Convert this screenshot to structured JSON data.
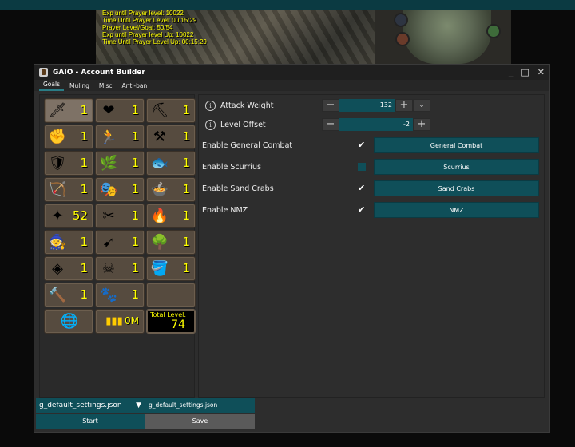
{
  "overlay": {
    "lines": [
      "Exp until Prayer level: 10022",
      "Time Until Prayer Level: 00:15:29",
      "Prayer Level/Goal: 50/54",
      "Exp until Prayer level Up: 10022",
      "Time Until Prayer Level Up: 00:15:29"
    ],
    "text_color": "#ffff00"
  },
  "window": {
    "title": "GAIO - Account Builder",
    "controls": [
      "_",
      "□",
      "✕"
    ]
  },
  "tabs": [
    "Goals",
    "Muling",
    "Misc",
    "Anti-ban"
  ],
  "skills": [
    {
      "icon": "attack",
      "glyph": "🗡",
      "level": "1",
      "selected": true
    },
    {
      "icon": "hitpoints",
      "glyph": "❤",
      "level": "1"
    },
    {
      "icon": "mining",
      "glyph": "⛏",
      "level": "1"
    },
    {
      "icon": "strength",
      "glyph": "✊",
      "level": "1"
    },
    {
      "icon": "agility",
      "glyph": "🏃",
      "level": "1"
    },
    {
      "icon": "smithing",
      "glyph": "⚒",
      "level": "1"
    },
    {
      "icon": "defence",
      "glyph": "🛡",
      "level": "1"
    },
    {
      "icon": "herblore",
      "glyph": "🌿",
      "level": "1"
    },
    {
      "icon": "fishing",
      "glyph": "🐟",
      "level": "1"
    },
    {
      "icon": "ranged",
      "glyph": "🏹",
      "level": "1"
    },
    {
      "icon": "thieving",
      "glyph": "🎭",
      "level": "1"
    },
    {
      "icon": "cooking",
      "glyph": "🍲",
      "level": "1"
    },
    {
      "icon": "prayer",
      "glyph": "✦",
      "level": "52"
    },
    {
      "icon": "crafting",
      "glyph": "✂",
      "level": "1"
    },
    {
      "icon": "firemaking",
      "glyph": "🔥",
      "level": "1"
    },
    {
      "icon": "magic",
      "glyph": "🧙",
      "level": "1"
    },
    {
      "icon": "fletching",
      "glyph": "➹",
      "level": "1"
    },
    {
      "icon": "woodcutting",
      "glyph": "🌳",
      "level": "1"
    },
    {
      "icon": "runecraft",
      "glyph": "◈",
      "level": "1"
    },
    {
      "icon": "slayer",
      "glyph": "☠",
      "level": "1"
    },
    {
      "icon": "farming",
      "glyph": "🪣",
      "level": "1"
    },
    {
      "icon": "construction",
      "glyph": "🔨",
      "level": "1"
    },
    {
      "icon": "hunter",
      "glyph": "🐾",
      "level": "1"
    }
  ],
  "bottom": {
    "money_value": "0M",
    "total_label": "Total Level:",
    "total_value": "74"
  },
  "settings": {
    "attack_weight": {
      "label": "Attack Weight",
      "value": "132"
    },
    "level_offset": {
      "label": "Level Offset",
      "value": "-2"
    },
    "toggles": [
      {
        "label": "Enable General Combat",
        "checked": true,
        "button": "General Combat"
      },
      {
        "label": "Enable Scurrius",
        "checked": false,
        "button": "Scurrius"
      },
      {
        "label": "Enable Sand Crabs",
        "checked": true,
        "button": "Sand Crabs"
      },
      {
        "label": "Enable NMZ",
        "checked": true,
        "button": "NMZ"
      }
    ]
  },
  "footer": {
    "profile_select": "g_default_settings.json",
    "profile_name": "g_default_settings.json",
    "start_label": "Start",
    "save_label": "Save"
  },
  "colors": {
    "accent": "#0f4f59",
    "skill_tile": "#564b3f",
    "level_text": "#ffff00"
  }
}
